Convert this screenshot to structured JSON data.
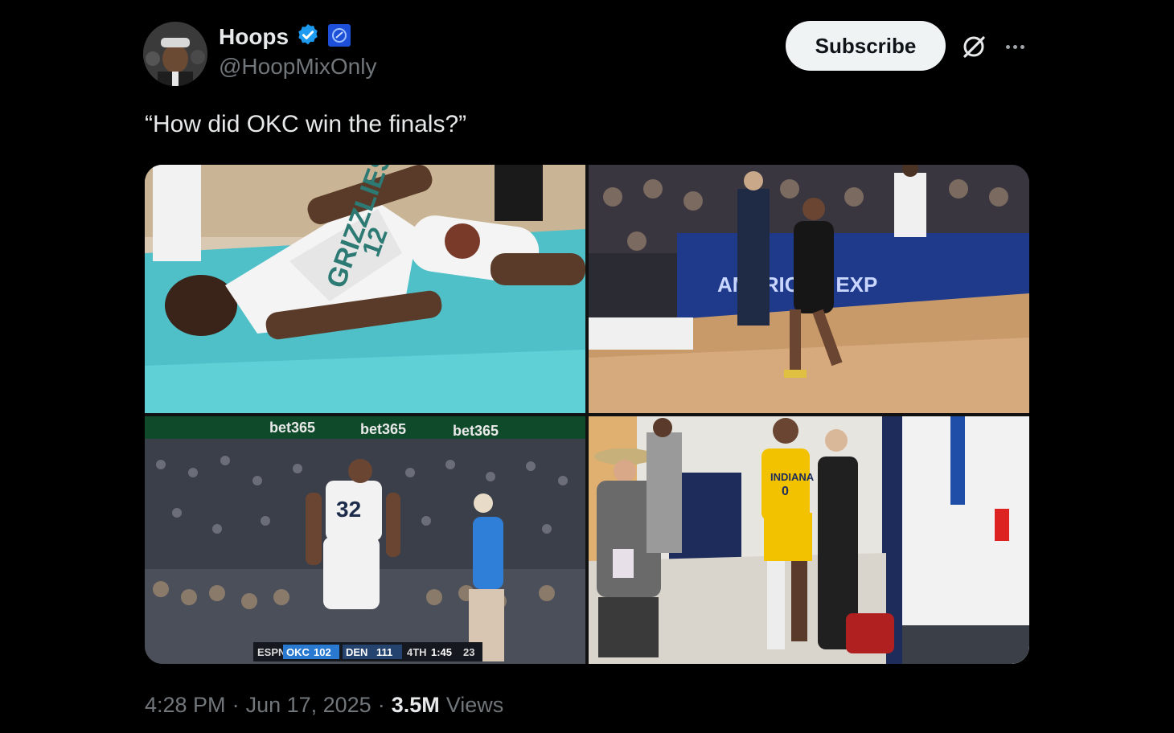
{
  "author": {
    "name": "Hoops",
    "handle": "@HoopMixOnly",
    "verified_icon": "verified-badge-icon",
    "affiliate_icon": "affiliate-badge-icon"
  },
  "actions": {
    "subscribe_label": "Subscribe",
    "grok_icon": "grok-icon",
    "more_icon": "more-icon"
  },
  "tweet": {
    "text": "“How did OKC win the finals?”"
  },
  "media": [
    {
      "jersey_team": "GRIZZLIES",
      "jersey_number": "12"
    },
    {
      "banner_text": "AMERICAN EXP"
    },
    {
      "ad_text": "bet365",
      "jersey_number": "32",
      "scorebug": {
        "network": "ESPN",
        "team1": "OKC",
        "score1": "102",
        "team2": "DEN",
        "score2": "111",
        "quarter": "4TH",
        "clock": "1:45",
        "shot_clock": "23"
      }
    },
    {
      "jersey_team": "INDIANA",
      "jersey_number": "0"
    }
  ],
  "meta": {
    "time": "4:28 PM",
    "date": "Jun 17, 2025",
    "views_count": "3.5M",
    "views_label": "Views",
    "separator": "·"
  }
}
